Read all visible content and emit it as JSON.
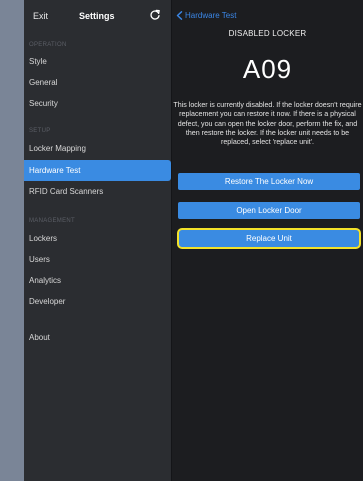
{
  "sidebar": {
    "exit_label": "Exit",
    "title": "Settings",
    "refresh_icon": "refresh-icon",
    "sections": {
      "operation": "OPERATION",
      "setup": "SETUP",
      "management": "MANAGEMENT"
    },
    "items": {
      "style": "Style",
      "general": "General",
      "security": "Security",
      "locker_mapping": "Locker Mapping",
      "hardware_test": "Hardware Test",
      "rfid": "RFID Card Scanners",
      "lockers": "Lockers",
      "users": "Users",
      "analytics": "Analytics",
      "developer": "Developer",
      "about": "About"
    },
    "active_item": "Hardware Test"
  },
  "main": {
    "back_label": "Hardware Test",
    "heading": "DISABLED LOCKER",
    "locker_id": "A09",
    "message": "This locker is currently disabled. If the locker doesn't require replacement you can restore it now. If there is a physical defect, you can open the locker door, perform the fix, and then restore the locker. If the locker unit needs to be replaced, select 'replace unit'.",
    "buttons": {
      "restore": "Restore The Locker Now",
      "open_door": "Open Locker Door",
      "replace": "Replace Unit"
    }
  },
  "colors": {
    "accent": "#3a8be2",
    "highlight": "#f3e22a",
    "sidebar_bg": "#2b2d31",
    "main_bg": "#1c1d20"
  }
}
